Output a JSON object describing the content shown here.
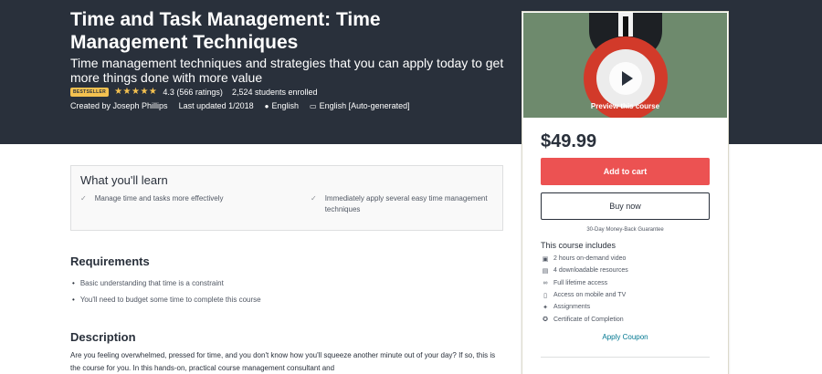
{
  "course": {
    "title": "Time and Task Management: Time Management Techniques",
    "subtitle": "Time management techniques and strategies that you can apply today to get more things done with more value",
    "badge": "BESTSELLER",
    "stars": "★★★★★",
    "rating": "4.3 (566 ratings)",
    "students": "2,524 students enrolled",
    "created_by": "Created by Joseph Phillips",
    "last_updated": "Last updated 1/2018",
    "language": "English",
    "captions": "English [Auto-generated]"
  },
  "sidebar": {
    "preview_label": "Preview this course",
    "price": "$49.99",
    "add_to_cart": "Add to cart",
    "buy_now": "Buy now",
    "guarantee": "30-Day Money-Back Guarantee",
    "includes_title": "This course includes",
    "includes": [
      {
        "icon": "video-icon",
        "text": "2 hours on-demand video"
      },
      {
        "icon": "file-icon",
        "text": "4 downloadable resources"
      },
      {
        "icon": "infinity-icon",
        "text": "Full lifetime access"
      },
      {
        "icon": "mobile-icon",
        "text": "Access on mobile and TV"
      },
      {
        "icon": "assignment-icon",
        "text": "Assignments"
      },
      {
        "icon": "certificate-icon",
        "text": "Certificate of Completion"
      }
    ],
    "apply_coupon": "Apply Coupon"
  },
  "learn": {
    "title": "What you'll learn",
    "points": [
      "Manage time and tasks more effectively",
      "Immediately apply several easy time management techniques"
    ]
  },
  "requirements": {
    "title": "Requirements",
    "items": [
      "Basic understanding that time is a constraint",
      "You'll need to budget some time to complete this course"
    ]
  },
  "description": {
    "title": "Description",
    "text": "Are you feeling overwhelmed, pressed for time, and you don't know how you'll squeeze another minute out of your day? If so, this is the course for you. In this hands-on, practical course management consultant and"
  },
  "colors": {
    "header_bg": "#29303b",
    "accent_red": "#ec5252",
    "star": "#f4c150",
    "link": "#007791"
  }
}
